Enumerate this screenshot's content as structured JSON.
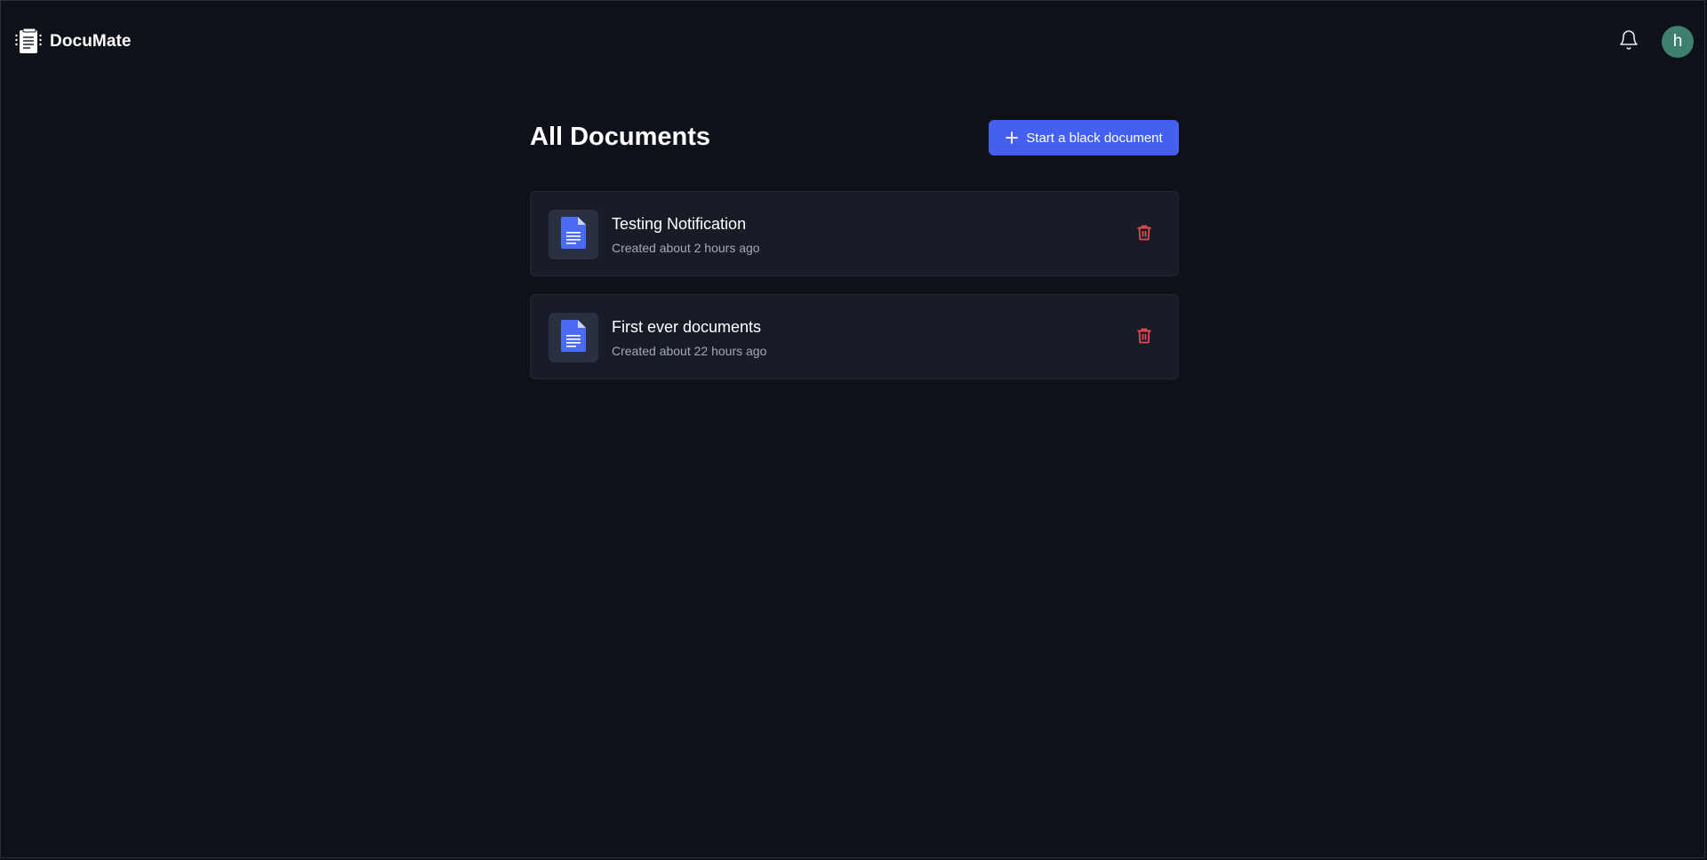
{
  "app": {
    "name": "DocuMate",
    "logo_icon": "documate-logo-icon"
  },
  "header": {
    "notifications_icon": "bell-icon",
    "avatar_initial": "h",
    "avatar_color": "#3f7f6e"
  },
  "main": {
    "title": "All Documents",
    "new_document_label": "Start a black document",
    "new_document_icon": "plus-icon",
    "accent_color": "#4560f0"
  },
  "documents": [
    {
      "title": "Testing Notification",
      "created": "Created about 2 hours ago",
      "icon": "document-icon",
      "delete_icon": "trash-icon"
    },
    {
      "title": "First ever documents",
      "created": "Created about 22 hours ago",
      "icon": "document-icon",
      "delete_icon": "trash-icon"
    }
  ],
  "colors": {
    "background": "#0e111a",
    "card": "#181c27",
    "delete": "#e5484d",
    "doc_icon": "#4b6bf5"
  }
}
